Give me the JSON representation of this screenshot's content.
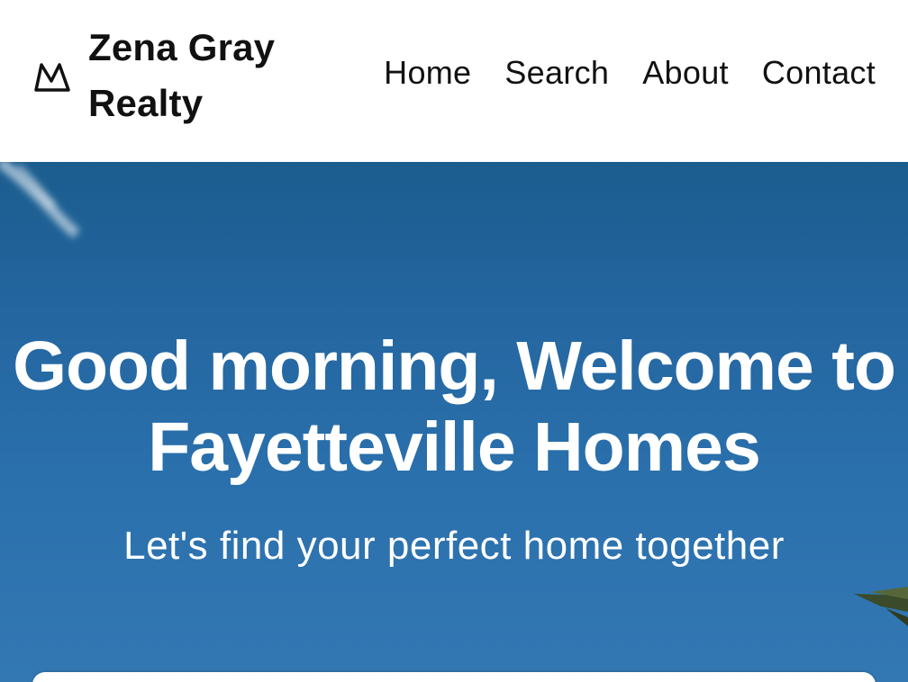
{
  "header": {
    "brand_icon": "mountain-crown-icon",
    "brand_name": "Zena Gray Realty",
    "nav": [
      {
        "label": "Home"
      },
      {
        "label": "Search"
      },
      {
        "label": "About"
      },
      {
        "label": "Contact"
      }
    ]
  },
  "hero": {
    "title": "Good morning, Welcome to Fayetteville Homes",
    "subtitle": "Let's find your perfect home together"
  },
  "colors": {
    "sky": "#2466a0",
    "text_dark": "#111111",
    "text_light": "#ffffff"
  }
}
